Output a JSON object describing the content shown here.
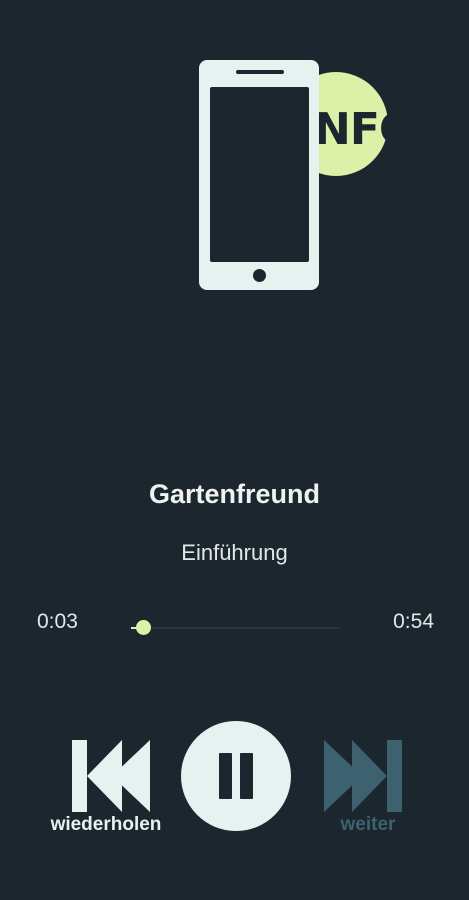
{
  "illustration": {
    "badge_text": "NFC",
    "badge_color": "#dcf0a8",
    "phone_color": "#e6f1f0"
  },
  "track": {
    "title": "Gartenfreund",
    "subtitle": "Einführung"
  },
  "progress": {
    "current_time": "0:03",
    "total_time": "0:54",
    "fraction": 0.056
  },
  "controls": {
    "replay_label": "wiederholen",
    "replay_icon": "skip-back-icon",
    "pause_icon": "pause-icon",
    "next_label": "weiter",
    "next_icon": "skip-forward-icon",
    "next_enabled": false
  },
  "colors": {
    "background": "#1b262e",
    "accent": "#dcf0a8",
    "disabled": "#3e6170"
  }
}
